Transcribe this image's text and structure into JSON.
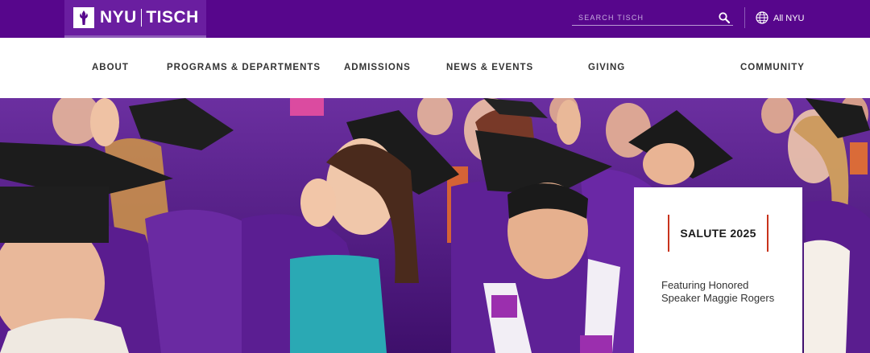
{
  "brand": {
    "logo_text_left": "NYU",
    "logo_text_right": "TISCH",
    "colors": {
      "purple": "#57068c",
      "accent_red": "#c8331c"
    }
  },
  "header": {
    "search_placeholder": "SEARCH TISCH",
    "all_nyu_label": "All NYU"
  },
  "nav": {
    "items": [
      {
        "label": "ABOUT"
      },
      {
        "label": "PROGRAMS & DEPARTMENTS"
      },
      {
        "label": "ADMISSIONS"
      },
      {
        "label": "NEWS & EVENTS"
      },
      {
        "label": "GIVING"
      },
      {
        "label": "COMMUNITY"
      }
    ]
  },
  "hero": {
    "card_title": "SALUTE 2025",
    "card_text": "Featuring Honored Speaker Maggie Rogers"
  },
  "icons": {
    "logo": "torch-icon",
    "search": "search-icon",
    "all_nyu": "globe-icon"
  }
}
